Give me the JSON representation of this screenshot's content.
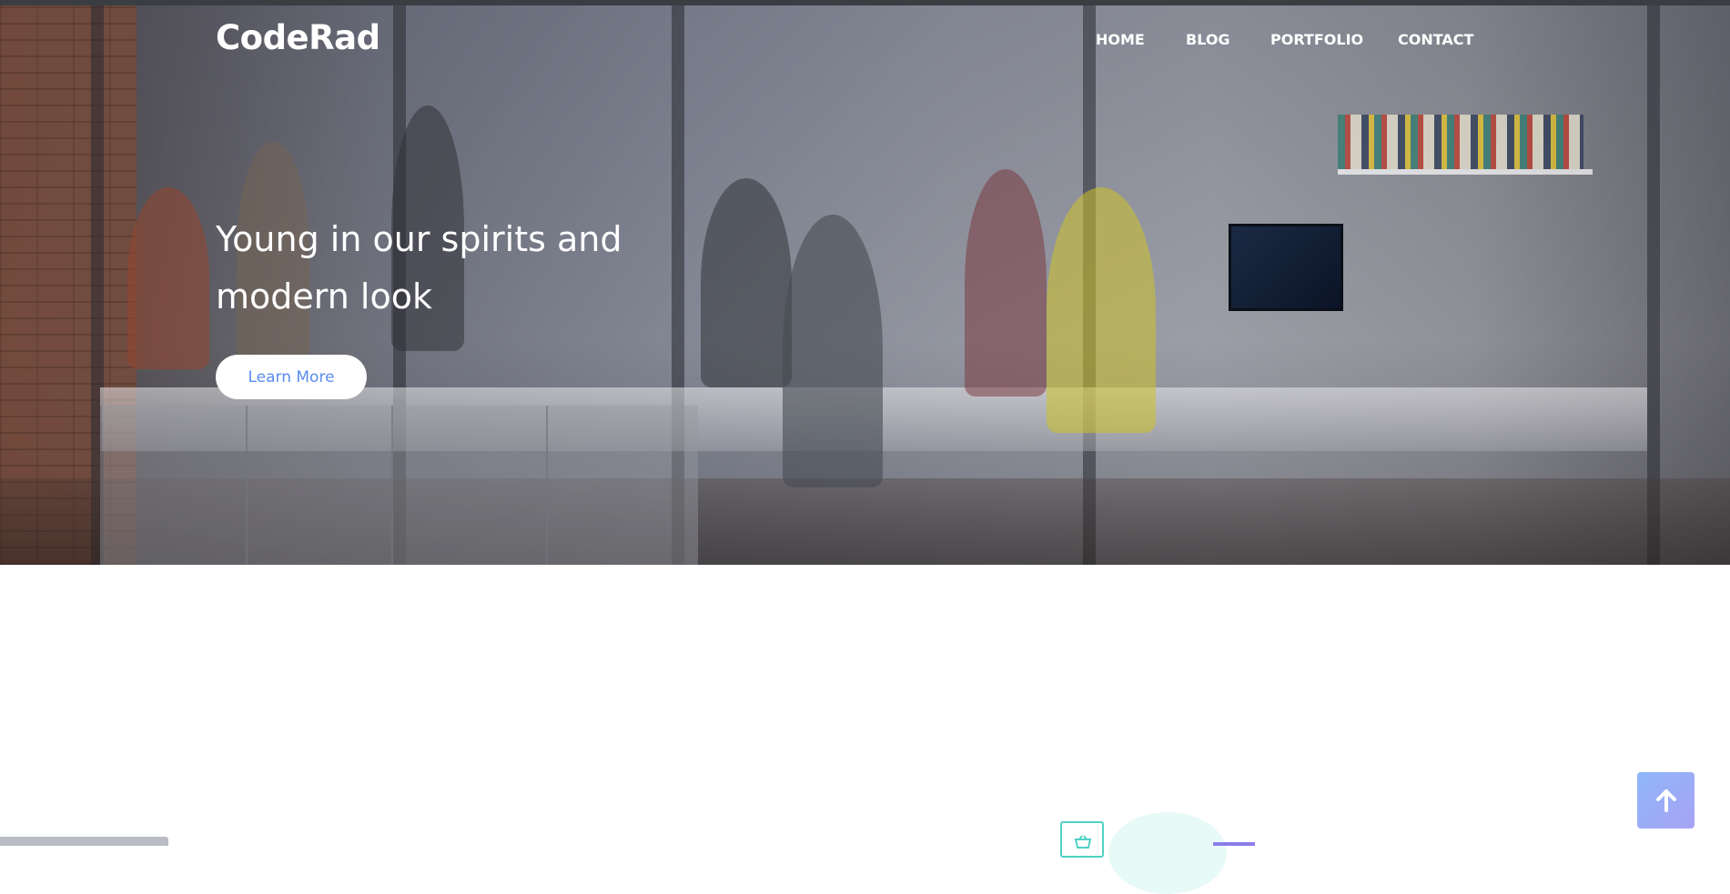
{
  "brand": {
    "name": "CodeRad"
  },
  "nav": {
    "items": [
      {
        "label": "HOME"
      },
      {
        "label": "BLOG"
      },
      {
        "label": "PORTFOLIO"
      },
      {
        "label": "CONTACT"
      }
    ]
  },
  "hero": {
    "headline_line1": "Young in our spirits and",
    "headline_line2": "modern look",
    "cta_label": "Learn More",
    "background_image": "office-team-photo"
  },
  "scroll_top": {
    "icon": "arrow-up-icon"
  },
  "colors": {
    "accent": "#5b8df0",
    "scroll_gradient_start": "#8fb6fb",
    "scroll_gradient_end": "#a7a3f3",
    "teal": "#4fd1c5"
  }
}
